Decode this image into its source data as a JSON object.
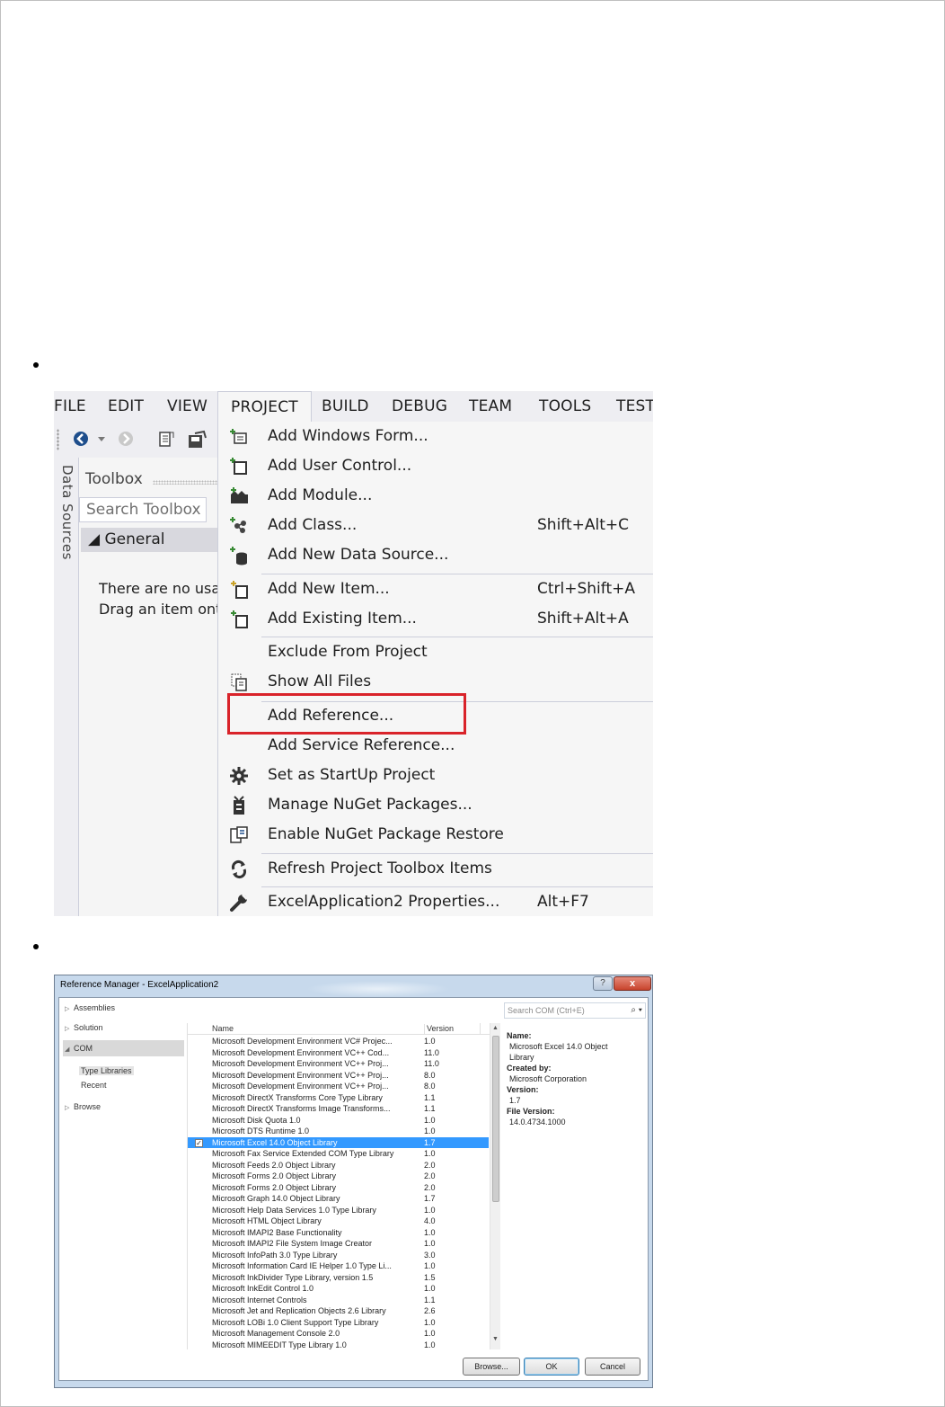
{
  "menubar": {
    "items": [
      "FILE",
      "EDIT",
      "VIEW",
      "PROJECT",
      "BUILD",
      "DEBUG",
      "TEAM",
      "TOOLS",
      "TEST"
    ],
    "open_item": "PROJECT"
  },
  "side_panel": {
    "vertical_tab": "Data Sources",
    "toolbox_title": "Toolbox",
    "search_placeholder": "Search Toolbox",
    "group_label": "◢ General",
    "empty_line1": "There are no usa",
    "empty_line2": "Drag an item ont"
  },
  "project_menu": {
    "items": [
      {
        "label": "Add Windows Form...",
        "shortcut": "",
        "icon": "windows-form-icon"
      },
      {
        "label": "Add User Control...",
        "shortcut": "",
        "icon": "user-control-icon"
      },
      {
        "label": "Add Module...",
        "shortcut": "",
        "icon": "module-icon"
      },
      {
        "label": "Add Class...",
        "shortcut": "Shift+Alt+C",
        "icon": "class-icon"
      },
      {
        "label": "Add New Data Source...",
        "shortcut": "",
        "icon": "data-source-icon"
      },
      {
        "label": "Add New Item...",
        "shortcut": "Ctrl+Shift+A",
        "icon": "new-item-icon"
      },
      {
        "label": "Add Existing Item...",
        "shortcut": "Shift+Alt+A",
        "icon": "existing-item-icon"
      },
      {
        "label": "Exclude From Project",
        "shortcut": "",
        "icon": ""
      },
      {
        "label": "Show All Files",
        "shortcut": "",
        "icon": "show-all-files-icon"
      },
      {
        "label": "Add Reference...",
        "shortcut": "",
        "icon": ""
      },
      {
        "label": "Add Service Reference...",
        "shortcut": "",
        "icon": ""
      },
      {
        "label": "Set as StartUp Project",
        "shortcut": "",
        "icon": "gear-icon"
      },
      {
        "label": "Manage NuGet Packages...",
        "shortcut": "",
        "icon": "nuget-icon"
      },
      {
        "label": "Enable NuGet Package Restore",
        "shortcut": "",
        "icon": "package-restore-icon"
      },
      {
        "label": "Refresh Project Toolbox Items",
        "shortcut": "",
        "icon": "refresh-icon"
      },
      {
        "label": "ExcelApplication2 Properties...",
        "shortcut": "Alt+F7",
        "icon": "wrench-icon"
      }
    ],
    "highlight_color": "#d9232a"
  },
  "reference_manager": {
    "title": "Reference Manager - ExcelApplication2",
    "help_label": "?",
    "close_label": "x",
    "nav": {
      "assemblies": "Assemblies",
      "solution": "Solution",
      "com": "COM",
      "type_libraries": "Type Libraries",
      "recent": "Recent",
      "browse": "Browse"
    },
    "search_placeholder": "Search COM (Ctrl+E)",
    "columns": {
      "name": "Name",
      "version": "Version"
    },
    "rows": [
      {
        "name": "Microsoft Development Environment VC# Projec...",
        "version": "1.0"
      },
      {
        "name": "Microsoft Development Environment VC++ Cod...",
        "version": "11.0"
      },
      {
        "name": "Microsoft Development Environment VC++ Proj...",
        "version": "11.0"
      },
      {
        "name": "Microsoft Development Environment VC++ Proj...",
        "version": "8.0"
      },
      {
        "name": "Microsoft Development Environment VC++ Proj...",
        "version": "8.0"
      },
      {
        "name": "Microsoft DirectX Transforms Core Type Library",
        "version": "1.1"
      },
      {
        "name": "Microsoft DirectX Transforms Image Transforms...",
        "version": "1.1"
      },
      {
        "name": "Microsoft Disk Quota 1.0",
        "version": "1.0"
      },
      {
        "name": "Microsoft DTS Runtime 1.0",
        "version": "1.0"
      },
      {
        "name": "Microsoft Excel 14.0 Object Library",
        "version": "1.7",
        "selected": true,
        "checked": true
      },
      {
        "name": "Microsoft Fax Service Extended COM Type Library",
        "version": "1.0"
      },
      {
        "name": "Microsoft Feeds 2.0 Object Library",
        "version": "2.0"
      },
      {
        "name": "Microsoft Forms 2.0 Object Library",
        "version": "2.0"
      },
      {
        "name": "Microsoft Forms 2.0 Object Library",
        "version": "2.0"
      },
      {
        "name": "Microsoft Graph 14.0 Object Library",
        "version": "1.7"
      },
      {
        "name": "Microsoft Help Data Services 1.0 Type Library",
        "version": "1.0"
      },
      {
        "name": "Microsoft HTML Object Library",
        "version": "4.0"
      },
      {
        "name": "Microsoft IMAPI2 Base Functionality",
        "version": "1.0"
      },
      {
        "name": "Microsoft IMAPI2 File System Image Creator",
        "version": "1.0"
      },
      {
        "name": "Microsoft InfoPath 3.0 Type Library",
        "version": "3.0"
      },
      {
        "name": "Microsoft Information Card IE Helper 1.0 Type Li...",
        "version": "1.0"
      },
      {
        "name": "Microsoft InkDivider Type Library, version 1.5",
        "version": "1.5"
      },
      {
        "name": "Microsoft InkEdit Control 1.0",
        "version": "1.0"
      },
      {
        "name": "Microsoft Internet Controls",
        "version": "1.1"
      },
      {
        "name": "Microsoft Jet and Replication Objects 2.6 Library",
        "version": "2.6"
      },
      {
        "name": "Microsoft LOBi 1.0 Client Support Type Library",
        "version": "1.0"
      },
      {
        "name": "Microsoft Management Console 2.0",
        "version": "1.0"
      },
      {
        "name": "Microsoft MIMEEDIT Type Library 1.0",
        "version": "1.0"
      }
    ],
    "details": {
      "name_label": "Name:",
      "name_value_line1": "Microsoft Excel 14.0 Object",
      "name_value_line2": "Library",
      "created_by_label": "Created by:",
      "created_by_value": "Microsoft Corporation",
      "version_label": "Version:",
      "version_value": "1.7",
      "file_version_label": "File Version:",
      "file_version_value": "14.0.4734.1000"
    },
    "buttons": {
      "browse": "Browse...",
      "ok": "OK",
      "cancel": "Cancel"
    },
    "selection_color": "#3399ff"
  }
}
